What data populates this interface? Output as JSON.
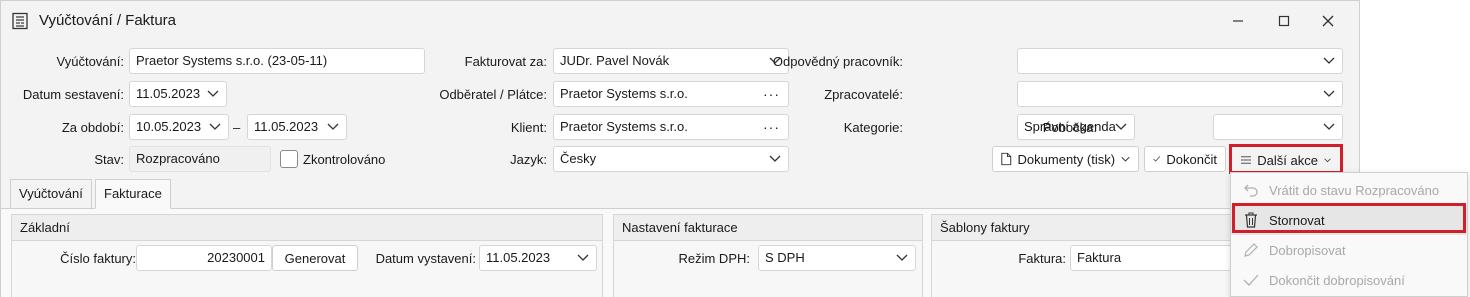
{
  "window": {
    "title": "Vyúčtování / Faktura"
  },
  "form": {
    "vyuctovani_label": "Vyúčtování:",
    "vyuctovani_value": "Praetor Systems s.r.o. (23-05-11)",
    "datum_label": "Datum sestavení:",
    "datum_value": "11.05.2023",
    "za_obdobi_label": "Za období:",
    "obdobi_od": "10.05.2023",
    "obdobi_dash": "–",
    "obdobi_do": "11.05.2023",
    "stav_label": "Stav:",
    "stav_value": "Rozpracováno",
    "zkontrolovano_label": "Zkontrolováno",
    "fakturovat_label": "Fakturovat za:",
    "fakturovat_value": "JUDr. Pavel Novák",
    "odberatel_label": "Odběratel / Plátce:",
    "odberatel_value": "Praetor Systems s.r.o.",
    "klient_label": "Klient:",
    "klient_value": "Praetor Systems s.r.o.",
    "jazyk_label": "Jazyk:",
    "jazyk_value": "Česky",
    "pracovnik_label": "Odpovědný pracovník:",
    "pracovnik_value": "",
    "zpracovatele_label": "Zpracovatelé:",
    "zpracovatele_value": "",
    "kategorie_label": "Kategorie:",
    "kategorie_value": "Správní agenda",
    "pobocka_label": "Pobočka:",
    "pobocka_value": "",
    "dots": "···"
  },
  "actions": {
    "dokumenty": "Dokumenty (tisk)",
    "dokoncit": "Dokončit",
    "dalsi_akce": "Další akce"
  },
  "tabs": [
    {
      "label": "Vyúčtování",
      "active": false
    },
    {
      "label": "Fakturace",
      "active": true
    }
  ],
  "panels": {
    "zakladni": {
      "title": "Základní",
      "cislo_label": "Číslo faktury:",
      "cislo_value": "20230001",
      "generovat": "Generovat",
      "datum_vystaveni_label": "Datum vystavení:",
      "datum_vystaveni_value": "11.05.2023"
    },
    "nastaveni": {
      "title": "Nastavení fakturace",
      "rezim_label": "Režim DPH:",
      "rezim_value": "S DPH"
    },
    "sablony": {
      "title": "Šablony faktury",
      "faktura_label": "Faktura:",
      "faktura_value": "Faktura"
    }
  },
  "menu": [
    {
      "label": "Vrátit do stavu Rozpracováno",
      "icon": "undo-icon",
      "disabled": true
    },
    {
      "label": "Stornovat",
      "icon": "trash-icon",
      "disabled": false
    },
    {
      "label": "Dobropisovat",
      "icon": "pencil-icon",
      "disabled": true
    },
    {
      "label": "Dokončit dobropisování",
      "icon": "check-icon",
      "disabled": true
    }
  ],
  "colors": {
    "highlight": "#d01f2b",
    "disabled_text": "#a8a8a8"
  }
}
